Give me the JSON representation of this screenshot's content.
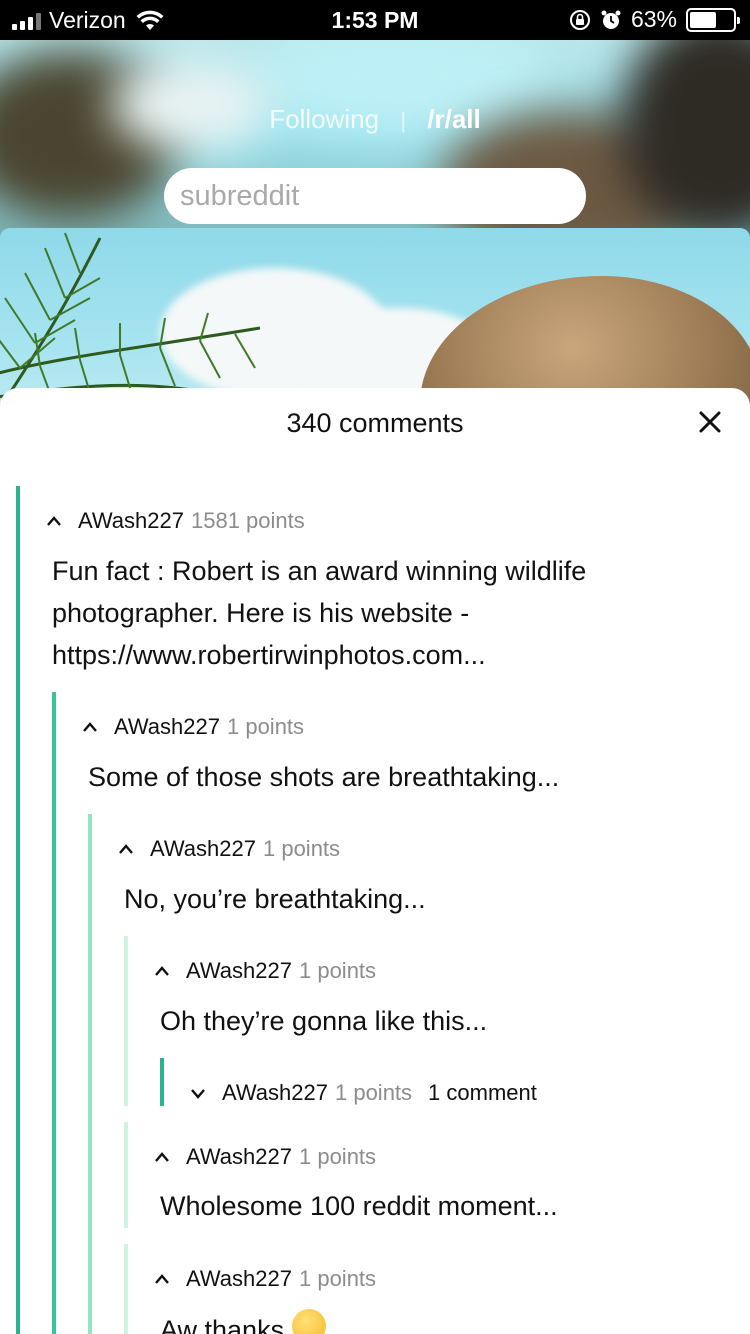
{
  "status_bar": {
    "carrier": "Verizon",
    "time": "1:53 PM",
    "battery": "63%"
  },
  "header": {
    "tab_following": "Following",
    "separator": "|",
    "tab_all": "/r/all",
    "search_placeholder": "subreddit"
  },
  "comments_sheet": {
    "title": "340 comments"
  },
  "comments": [
    {
      "author": "AWash227",
      "points": "1581 points",
      "body": "Fun fact : Robert is an award winning wildlife photographer. Here is his website - https://www.robertirwinphotos.com..."
    },
    {
      "author": "AWash227",
      "points": "1 points",
      "body": "Some of those shots are breathtaking..."
    },
    {
      "author": "AWash227",
      "points": "1 points",
      "body": "No, you’re breathtaking..."
    },
    {
      "author": "AWash227",
      "points": "1 points",
      "body": "Oh they’re gonna like this..."
    },
    {
      "author": "AWash227",
      "points": "1 points",
      "collapsed_count": "1 comment"
    },
    {
      "author": "AWash227",
      "points": "1 points",
      "body": "Wholesome 100 reddit moment..."
    },
    {
      "author": "AWash227",
      "points": "1 points",
      "body": "Aw thanks"
    }
  ],
  "colors": {
    "thread_level_1": "#2bb38f",
    "thread_level_2": "#39c49a",
    "thread_level_3": "#93e6c5",
    "thread_level_4": "#cff3e2",
    "points_text": "#8c8c8c"
  },
  "icons": {
    "expand": "chevron-up-icon",
    "collapsed": "chevron-down-icon",
    "close": "close-icon",
    "emoji": "smiling-face-emoji-icon"
  }
}
